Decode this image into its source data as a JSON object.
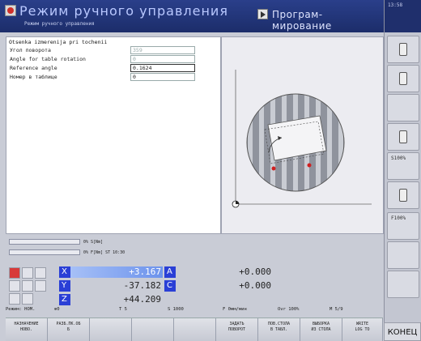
{
  "header": {
    "mode_title": "Режим ручного управления",
    "mode_subtitle": "Режим ручного управления",
    "program_title": "Програм- мирование",
    "clock": "13:58"
  },
  "form": {
    "title": "Otsenka izmerenija pri tochenii",
    "rows": [
      {
        "label": "Угол поворота",
        "value": "359"
      },
      {
        "label": "Angle for table rotation",
        "value": "0"
      },
      {
        "label": "Reference angle",
        "value": "0.1624"
      },
      {
        "label": "Номер в таблице",
        "value": "0"
      }
    ]
  },
  "status": {
    "line1": "0% S[Nm]",
    "line2": "0% F[Nm] ST   10:30"
  },
  "positions": {
    "axes": [
      {
        "name": "X",
        "value": "+3.167"
      },
      {
        "name": "Y",
        "value": "-37.182"
      },
      {
        "name": "Z",
        "value": "+44.209"
      }
    ],
    "aux_axes": [
      {
        "name": "A",
        "value": "+0.000"
      },
      {
        "name": "C",
        "value": "+0.000"
      }
    ],
    "axis_color": "#2a3fd6",
    "highlight_color": "#7aa0f0"
  },
  "info": {
    "mode": "Режим: НОМ.",
    "t0": "⊕0",
    "t": "T 5",
    "s": "S 1000",
    "f": "F 0мм/мин",
    "ovr": "Ovr 100%",
    "m": "M 5/9"
  },
  "softkeys": [
    {
      "label": "НАЗНАЧЕНИЕ\nНОВО."
    },
    {
      "label": "РАЗБ.ПК.ОБ\nБ"
    },
    {
      "label": ""
    },
    {
      "label": ""
    },
    {
      "label": ""
    },
    {
      "label": "ЗАДАТЬ\nПОВОРОТ"
    },
    {
      "label": "ПОВ.СТОЛА\nВ ТАБЛ."
    },
    {
      "label": "ВЫБОРКА\nИЗ СТОЛА"
    },
    {
      "label": "WRITE\nLOG TO"
    }
  ],
  "right_keys": [
    {
      "label": "S100%"
    },
    {
      "label": "F100%"
    }
  ],
  "end_label": "КОНЕЦ"
}
